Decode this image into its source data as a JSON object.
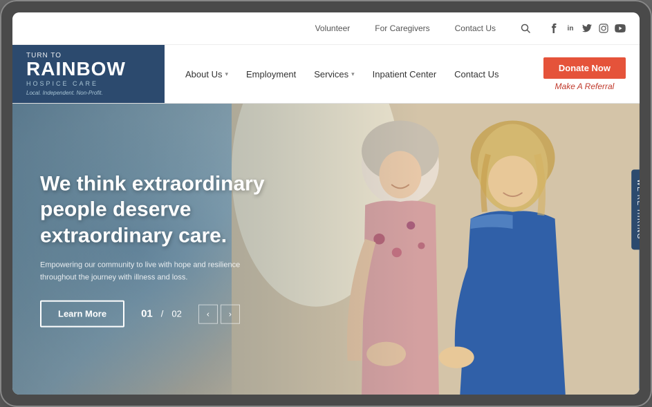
{
  "device": {
    "frame_label": "browser-device"
  },
  "top_nav": {
    "links": [
      {
        "label": "Volunteer",
        "id": "volunteer"
      },
      {
        "label": "For Caregivers",
        "id": "for-caregivers"
      },
      {
        "label": "Contact Us",
        "id": "contact-us-top"
      }
    ],
    "social": [
      {
        "icon": "facebook-icon",
        "symbol": "f"
      },
      {
        "icon": "linkedin-icon",
        "symbol": "in"
      },
      {
        "icon": "twitter-icon",
        "symbol": "𝕏"
      },
      {
        "icon": "instagram-icon",
        "symbol": "◎"
      },
      {
        "icon": "youtube-icon",
        "symbol": "▶"
      }
    ]
  },
  "logo": {
    "top_text": "Turn to",
    "main_text": "RAINBOW",
    "sub_text": "HOSPICE CARE",
    "tagline": "Local. Independent. Non-Profit."
  },
  "main_nav": {
    "links": [
      {
        "label": "About Us",
        "has_dropdown": true
      },
      {
        "label": "Employment",
        "has_dropdown": false
      },
      {
        "label": "Services",
        "has_dropdown": true
      },
      {
        "label": "Inpatient Center",
        "has_dropdown": false
      },
      {
        "label": "Contact Us",
        "has_dropdown": false
      }
    ],
    "donate_label": "Donate Now",
    "referral_label": "Make A Referral"
  },
  "hero": {
    "heading": "We think extraordinary people deserve extraordinary care.",
    "subtext": "Empowering our community to live with hope and resilience throughout the journey with illness and loss.",
    "learn_more_label": "Learn More",
    "slide_current": "01",
    "slide_separator": "/",
    "slide_total": "02",
    "prev_label": "‹",
    "next_label": "›",
    "we_hiring_label": "We're Hiring"
  },
  "colors": {
    "logo_bg": "#2c4a6e",
    "donate_bg": "#e5533a",
    "donate_text": "#ffffff",
    "referral_text": "#c0392b",
    "nav_text": "#333333",
    "hero_text": "#ffffff"
  }
}
